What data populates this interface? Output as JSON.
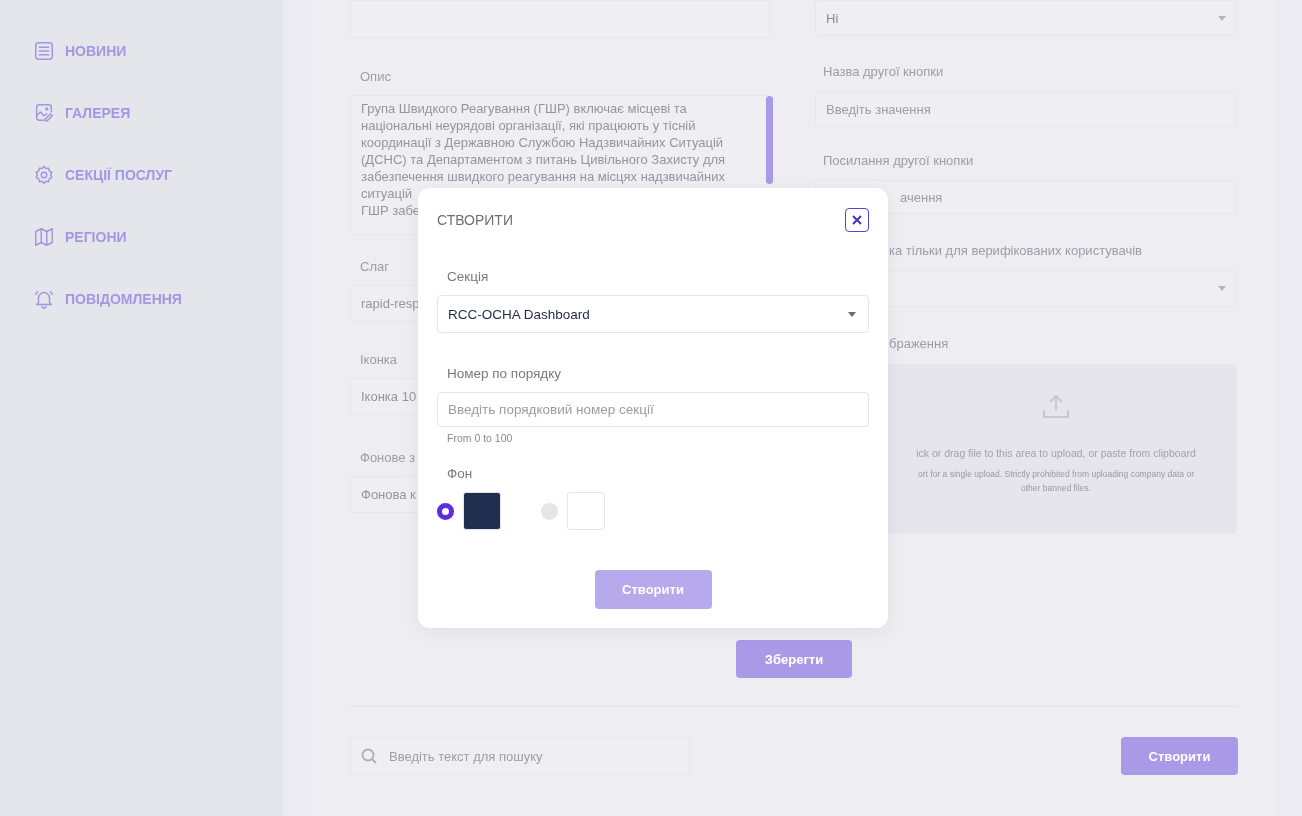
{
  "sidebar": {
    "items": [
      {
        "kind": "news",
        "label": "НОВИНИ"
      },
      {
        "kind": "gallery",
        "label": "ГАЛЕРЕЯ"
      },
      {
        "kind": "gear",
        "label": "СЕКЦІЇ ПОСЛУГ"
      },
      {
        "kind": "map",
        "label": "РЕГІОНИ"
      },
      {
        "kind": "bell",
        "label": "ПОВІДОМЛЕННЯ"
      }
    ]
  },
  "form": {
    "description": {
      "label": "Опис",
      "lines": [
        "Група Швидкого Реагування (ГШР) включає місцеві та",
        "національні неурядові організації, які працюють у тісній",
        "координації з Державною Службою Надзвичайних Ситуацій",
        "(ДСНС) та Департаментом з питань Цивільного Захисту для",
        "забезпечення швидкого реагування на місцях надзвичайних",
        "ситуацій",
        "ГШР забе"
      ]
    },
    "slug": {
      "label": "Слаг",
      "value": "rapid-resp"
    },
    "icon": {
      "label": "Іконка",
      "value": "Іконка 10"
    },
    "background_image": {
      "label": "Фонове з",
      "value": "Фонова к"
    },
    "top_select": {
      "value": "Ні"
    },
    "second_button_name": {
      "label": "Назва другої кнопки",
      "placeholder": "Введіть значення"
    },
    "second_button_link": {
      "label": "Посилання другої кнопки",
      "placeholder": "ачення"
    },
    "verified_only": {
      "label": "ка тільки для верифікованих користувачів"
    },
    "image": {
      "label": "браження",
      "upload_text": "ick or drag file to this area to upload, or paste from clipboard",
      "upload_hint": "ort for a single upload. Strictly prohibited from uploading company data or",
      "upload_hint_2": "other banned files."
    },
    "save_button": "Зберегти"
  },
  "search": {
    "placeholder": "Введіть текст для пошуку"
  },
  "create_button": "Створити",
  "modal": {
    "title": "СТВОРИТИ",
    "section_label": "Секція",
    "section_value": "RCC-OCHA Dashboard",
    "order_label": "Номер по порядку",
    "order_placeholder": "Введіть порядковий номер секції",
    "order_help": "From 0 to 100",
    "background_label": "Фон",
    "background_options": [
      {
        "color": "#1f2d4e",
        "selected": true
      },
      {
        "color": "#ffffff",
        "selected": false
      }
    ],
    "submit_button": "Створити",
    "submit_disabled": true
  }
}
